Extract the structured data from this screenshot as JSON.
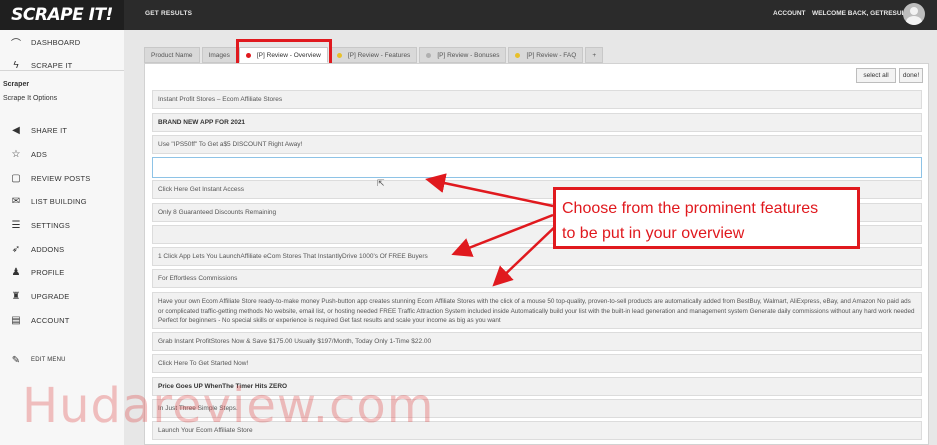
{
  "topbar": {
    "logo": "SCRAPE IT!",
    "title": "GET RESULTS",
    "account": "ACCOUNT",
    "welcome": "WELCOME BACK, GETRESULTS"
  },
  "sidebar": {
    "items": [
      {
        "label": "DASHBOARD",
        "icon": "dashboard-icon",
        "glyph": "⌒"
      },
      {
        "label": "SCRAPE IT",
        "icon": "bolt-icon",
        "glyph": "ϟ"
      },
      {
        "label": "SHARE IT",
        "icon": "megaphone-icon",
        "glyph": "◀"
      },
      {
        "label": "ADS",
        "icon": "star-icon",
        "glyph": "☆"
      },
      {
        "label": "REVIEW POSTS",
        "icon": "document-icon",
        "glyph": "▢"
      },
      {
        "label": "LIST BUILDING",
        "icon": "envelope-icon",
        "glyph": "✉"
      },
      {
        "label": "SETTINGS",
        "icon": "sliders-icon",
        "glyph": "☰"
      },
      {
        "label": "ADDONS",
        "icon": "rocket-icon",
        "glyph": "➶"
      },
      {
        "label": "PROFILE",
        "icon": "user-icon",
        "glyph": "♟"
      },
      {
        "label": "UPGRADE",
        "icon": "chess-icon",
        "glyph": "♜"
      },
      {
        "label": "ACCOUNT",
        "icon": "id-card-icon",
        "glyph": "▤"
      },
      {
        "label": "EDIT MENU",
        "icon": "pencil-icon",
        "glyph": "✎"
      }
    ],
    "sub_head": "Scraper",
    "sub_item": "Scrape It Options"
  },
  "tabs": [
    {
      "label": "Product Name",
      "dot": ""
    },
    {
      "label": "Images",
      "dot": ""
    },
    {
      "label": "[P] Review - Overview",
      "dot": "#e0191e"
    },
    {
      "label": "[P] Review - Features",
      "dot": "#e8c02a"
    },
    {
      "label": "[P] Review - Bonuses",
      "dot": "#b0b0b0"
    },
    {
      "label": "[P] Review - FAQ",
      "dot": "#e8c02a"
    },
    {
      "label": "+",
      "dot": ""
    }
  ],
  "buttons": {
    "select_all": "select all",
    "done": "done!"
  },
  "rows": [
    "Instant Profit Stores – Ecom Affiliate Stores",
    "BRAND NEW APP FOR 2021",
    "Use \"IPS50ff\" To Get a$5 DISCOUNT Right Away!",
    "",
    "Click Here Get Instant Access",
    "Only 8 Guaranteed Discounts Remaining",
    "",
    "1 Click App Lets You LaunchAffiliate eCom Stores That InstantlyDrive 1000's Of FREE Buyers",
    "For Effortless Commissions",
    "Have your own Ecom Affiliate Store ready-to-make money Push-button app creates stunning Ecom Affiliate Stores with the click of a mouse 50 top-quality, proven-to-sell products are automatically added from BestBuy, Walmart, AliExpress, eBay, and Amazon No paid ads or complicated traffic-getting methods No website, email list, or hosting needed FREE Traffic Attraction System included inside Automatically build your list with the built-in lead generation and management system Generate daily commissions without any hard work needed Perfect for beginners - No special skills or experience is required Get fast results and scale your income as big as you want",
    "Grab Instant ProfitStores Now & Save $175.00 Usually $197/Month, Today Only 1-Time $22.00",
    "Click Here To Get Started Now!",
    "Price Goes UP WhenThe Timer Hits ZERO",
    "In Just Three Simple Steps.",
    "Launch Your Ecom Affiliate Store"
  ],
  "annotation": {
    "line1": "Choose from the prominent features",
    "line2": "to be put in your overview",
    "color": "#e0191e"
  },
  "watermark": "Hudareview.com"
}
